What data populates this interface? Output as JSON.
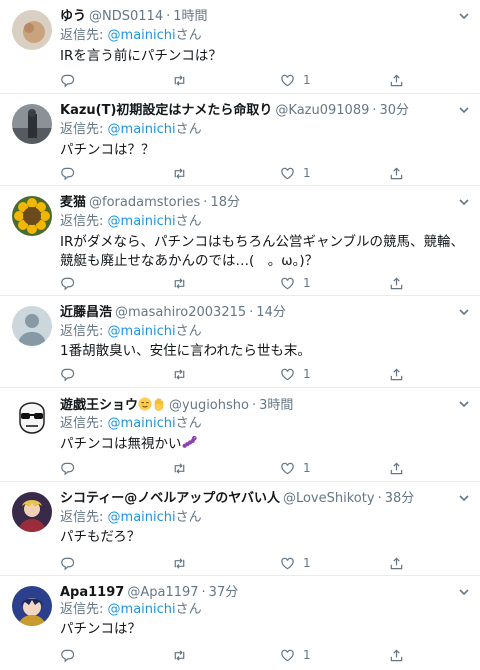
{
  "reply_prefix": "返信先:",
  "reply_suffix": "さん",
  "tweets": [
    {
      "name": "ゆう",
      "handle": "@NDS0114",
      "time": "1時間",
      "reply_to": "@mainichi",
      "text": "IRを言う前にパチンコは？",
      "likes": "1"
    },
    {
      "name": "Kazu(T)初期設定はナメたら命取り",
      "handle": "@Kazu091089",
      "time": "30分",
      "reply_to": "@mainichi",
      "text": "パチンコは？？",
      "likes": "1"
    },
    {
      "name": "麦猫",
      "handle": "@foradamstories",
      "time": "18分",
      "reply_to": "@mainichi",
      "text": "IRがダメなら、パチンコはもちろん公営ギャンブルの競馬、競輪、競艇も廃止せなあかんのでは…(　。ω。)？",
      "likes": "1"
    },
    {
      "name": "近藤昌浩",
      "handle": "@masahiro2003215",
      "time": "14分",
      "reply_to": "@mainichi",
      "text": "1番胡散臭い、安住に言われたら世も末。",
      "likes": "1"
    },
    {
      "name": "遊戯王ショウ",
      "handle": "@yugiohsho",
      "time": "3時間",
      "reply_to": "@mainichi",
      "text": "パチンコは無視かい",
      "likes": "1"
    },
    {
      "name": "シコティー@ノベルアップのヤバい人",
      "handle": "@LoveShikoty",
      "time": "38分",
      "reply_to": "@mainichi",
      "text": "パチもだろ？",
      "likes": "1"
    },
    {
      "name": "Apa1197",
      "handle": "@Apa1197",
      "time": "37分",
      "reply_to": "@mainichi",
      "text": "パチンコは？",
      "likes": "1"
    }
  ],
  "icons": {
    "reply": "reply-icon",
    "retweet": "retweet-icon",
    "like": "heart-icon",
    "share": "share-icon",
    "menu": "chevron-down-icon"
  },
  "colors": {
    "link": "#1b95e0",
    "muted": "#657786",
    "text": "#14171a",
    "divider": "#e6ecf0"
  }
}
